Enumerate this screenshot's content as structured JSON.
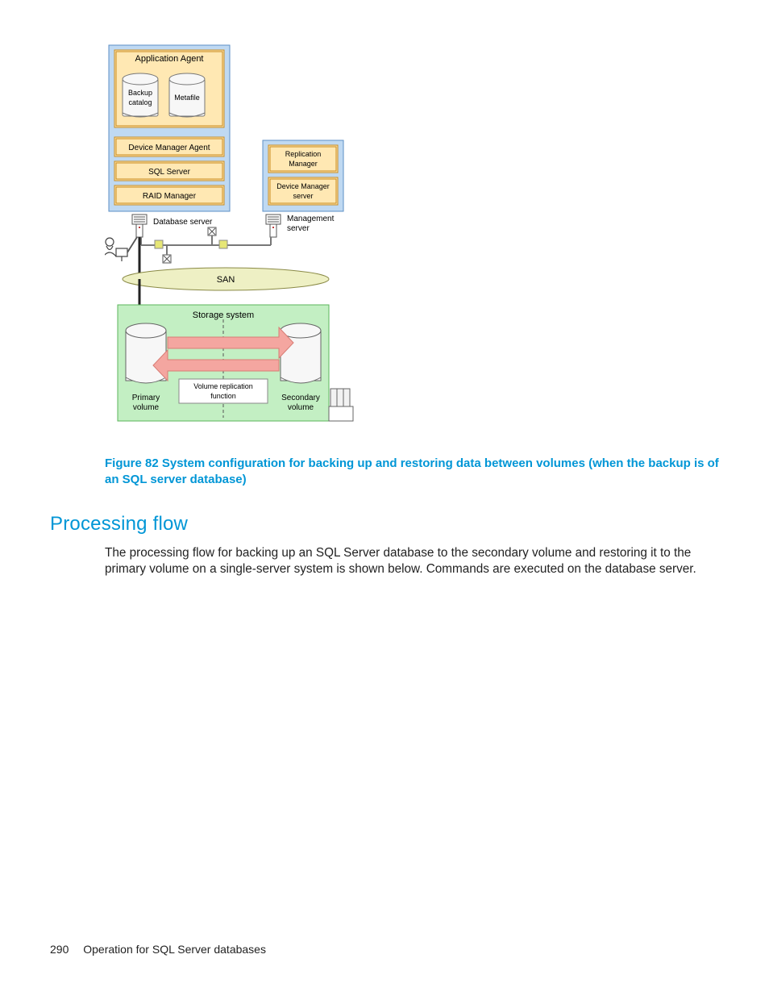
{
  "diagram": {
    "db_box_title": "Application Agent",
    "backup_catalog_l1": "Backup",
    "backup_catalog_l2": "catalog",
    "metafile": "Metafile",
    "dm_agent": "Device Manager Agent",
    "sql_server": "SQL Server",
    "raid_manager": "RAID Manager",
    "db_server": "Database server",
    "mgmt_box_repl_l1": "Replication",
    "mgmt_box_repl_l2": "Manager",
    "mgmt_box_dm_l1": "Device Manager",
    "mgmt_box_dm_l2": "server",
    "mgmt_server_l1": "Management",
    "mgmt_server_l2": "server",
    "san": "SAN",
    "storage_system": "Storage system",
    "vol_repl_l1": "Volume replication",
    "vol_repl_l2": "function",
    "primary_l1": "Primary",
    "primary_l2": "volume",
    "secondary_l1": "Secondary",
    "secondary_l2": "volume"
  },
  "caption": "Figure 82 System configuration for backing up and restoring data between volumes (when the backup is of an SQL server database)",
  "section_heading": "Processing flow",
  "body_text": "The processing flow for backing up an SQL Server database to the secondary volume and restoring it to the primary volume on a single-server system is shown below. Commands are executed on the database server.",
  "footer": {
    "page_number": "290",
    "section_title": "Operation for SQL Server databases"
  }
}
